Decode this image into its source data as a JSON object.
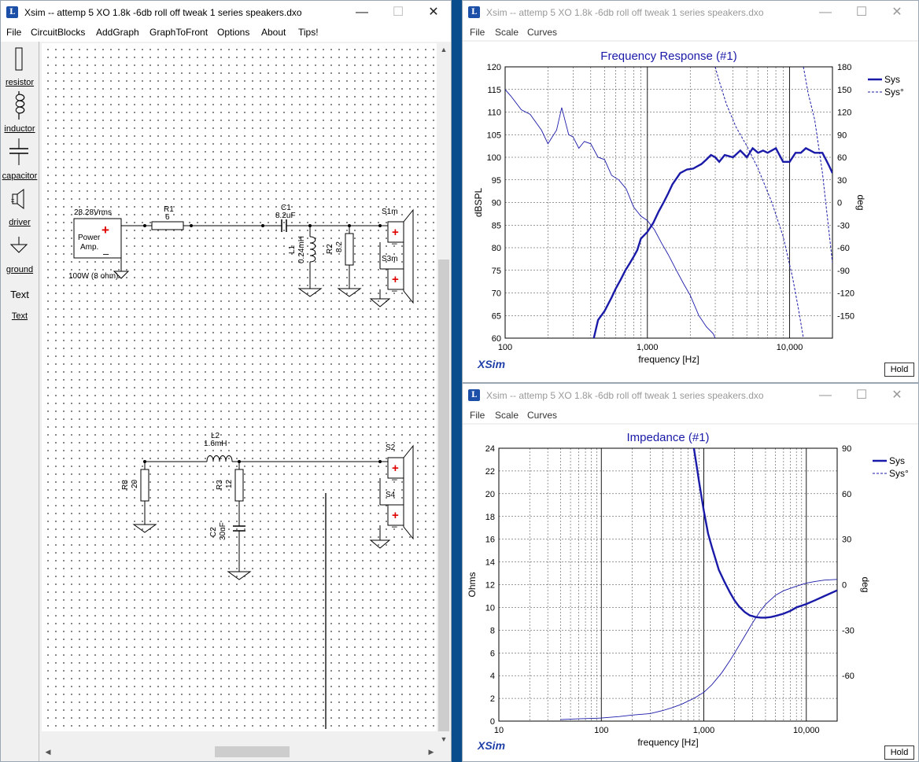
{
  "left_window": {
    "title": "Xsim -- attemp 5 XO 1.8k -6db roll off tweak 1 series speakers.dxo",
    "menu": [
      "File",
      "CircuitBlocks",
      "AddGraph",
      "GraphToFront",
      "Options",
      "About",
      "Tips!"
    ],
    "palette": [
      {
        "label": "resistor",
        "icon": "resistor-icon"
      },
      {
        "label": "inductor",
        "icon": "inductor-icon"
      },
      {
        "label": "capacitor",
        "icon": "capacitor-icon"
      },
      {
        "label": "driver",
        "icon": "driver-icon"
      },
      {
        "label": "ground",
        "icon": "ground-icon"
      },
      {
        "label": "Text",
        "icon": "text-icon"
      }
    ],
    "circuit": {
      "amp_voltage": "28.28Vrms",
      "amp_label_1": "Power",
      "amp_label_2": "Amp.",
      "amp_power": "100W (8 ohm)",
      "plus": "+",
      "minus": "–",
      "r1_name": "R1",
      "r1_value": "6",
      "c1_name": "C1",
      "c1_value": "8.2uF",
      "l1_name": "L1",
      "l1_value": "0.24mH",
      "r2_name": "R2",
      "r2_value": "8.2",
      "s1_name": "S1m",
      "s3_name": "S3m",
      "l2_name": "L2",
      "l2_value": "1.6mH",
      "r8_name": "R8",
      "r8_value": "20",
      "r3_name": "R3",
      "r3_value": "12",
      "c2_name": "C2",
      "c2_value": "30uF",
      "s2_name": "S2",
      "s4_name": "S4"
    }
  },
  "freq_window": {
    "title": "Xsim -- attemp 5 XO 1.8k -6db roll off tweak 1 series speakers.dxo",
    "menu": [
      "File",
      "Scale",
      "Curves"
    ],
    "hold_label": "Hold",
    "logo": "XSim"
  },
  "imp_window": {
    "title": "Xsim -- attemp 5 XO 1.8k -6db roll off tweak 1 series speakers.dxo",
    "menu": [
      "File",
      "Scale",
      "Curves"
    ],
    "hold_label": "Hold",
    "logo": "XSim"
  },
  "chart_data": [
    {
      "type": "line",
      "title": "Frequency Response (#1)",
      "xlabel": "frequency [Hz]",
      "ylabel": "dBSPL",
      "y2label": "deg",
      "xscale": "log",
      "xlim": [
        100,
        20000
      ],
      "ylim": [
        60,
        120
      ],
      "y2lim": [
        -180,
        180
      ],
      "x_ticks": [
        "100",
        "1,000",
        "10,000"
      ],
      "y_ticks": [
        60,
        65,
        70,
        75,
        80,
        85,
        90,
        95,
        100,
        105,
        110,
        115,
        120
      ],
      "y2_ticks": [
        -150,
        -120,
        -90,
        -60,
        -30,
        0,
        30,
        60,
        90,
        120,
        150,
        180
      ],
      "legend_position": "top-right",
      "grid": true,
      "accent_color": "#1a1aa8",
      "series": [
        {
          "name": "Sys",
          "axis": "left",
          "style": "solid-thick",
          "x": [
            420,
            450,
            500,
            560,
            600,
            650,
            700,
            750,
            800,
            850,
            900,
            1000,
            1100,
            1200,
            1300,
            1400,
            1500,
            1700,
            1900,
            2100,
            2400,
            2600,
            2800,
            3000,
            3200,
            3500,
            4000,
            4500,
            5000,
            5500,
            6000,
            6500,
            7000,
            8000,
            9000,
            10000,
            11000,
            12000,
            13000,
            14000,
            15000,
            16000,
            17000,
            18000,
            19000,
            20000
          ],
          "y": [
            60,
            64,
            66,
            69,
            71,
            73,
            75,
            76.5,
            78,
            79.5,
            82,
            83.5,
            85.5,
            88,
            90,
            92,
            94,
            96.5,
            97.3,
            97.5,
            98.5,
            99.5,
            100.5,
            100,
            99,
            100.5,
            100,
            101.5,
            100,
            102,
            101,
            101.5,
            101,
            102,
            99,
            99,
            101,
            101,
            102,
            101.5,
            101,
            101,
            101,
            99.5,
            98,
            96.5
          ]
        },
        {
          "name": "Sys°",
          "axis": "right",
          "style": "dashed",
          "x": [
            3000,
            3000,
            3150,
            3600,
            4200,
            5000,
            6000,
            7500,
            9000,
            10500,
            11500,
            12500,
            12500,
            13500,
            15000,
            17000,
            20000
          ],
          "y": [
            -180,
            180,
            165,
            130,
            100,
            75,
            45,
            0,
            -45,
            -100,
            -140,
            -180,
            180,
            145,
            110,
            40,
            -80
          ]
        },
        {
          "name": "",
          "axis": "left",
          "style": "thin",
          "x": [
            100,
            110,
            130,
            150,
            180,
            200,
            230,
            250,
            280,
            300,
            330,
            360,
            400,
            450,
            500,
            560,
            630,
            710,
            800,
            900,
            1000,
            1120,
            1260,
            1400,
            1600,
            1800,
            2000,
            2300,
            2600,
            2900,
            3000
          ],
          "y": [
            115,
            113.5,
            110.5,
            109.5,
            106,
            103,
            106,
            111,
            105,
            104.5,
            102,
            103.5,
            103,
            100,
            99.5,
            96,
            95,
            93,
            89,
            87,
            86,
            84,
            81,
            78.5,
            75,
            72,
            69.5,
            65,
            62.5,
            61,
            60
          ]
        }
      ]
    },
    {
      "type": "line",
      "title": "Impedance (#1)",
      "xlabel": "frequency [Hz]",
      "ylabel": "Ohms",
      "y2label": "deg",
      "xscale": "log",
      "xlim": [
        10,
        20000
      ],
      "ylim": [
        0,
        24
      ],
      "y2lim": [
        -90,
        90
      ],
      "x_ticks": [
        "10",
        "100",
        "1,000",
        "10,000"
      ],
      "y_ticks": [
        0,
        2,
        4,
        6,
        8,
        10,
        12,
        14,
        16,
        18,
        20,
        22,
        24
      ],
      "y2_ticks": [
        -60,
        -30,
        0,
        30,
        60,
        90
      ],
      "legend_position": "top-right",
      "grid": true,
      "series": [
        {
          "name": "Sys",
          "axis": "left",
          "style": "solid-thick",
          "x": [
            800,
            850,
            900,
            1000,
            1100,
            1200,
            1400,
            1600,
            1800,
            2000,
            2200,
            2500,
            2800,
            3200,
            3600,
            4000,
            4500,
            5000,
            6000,
            7000,
            8000,
            10000,
            12000,
            15000,
            20000
          ],
          "y": [
            24,
            22.5,
            21,
            18.5,
            16.5,
            15.3,
            13.3,
            12.2,
            11.3,
            10.6,
            10.1,
            9.6,
            9.3,
            9.15,
            9.1,
            9.1,
            9.15,
            9.25,
            9.45,
            9.7,
            10,
            10.3,
            10.6,
            11,
            11.5
          ]
        },
        {
          "name": "Sys°",
          "axis": "right",
          "style": "dashed",
          "x": [],
          "y": []
        },
        {
          "name": "",
          "axis": "right",
          "style": "thin",
          "x": [
            40,
            60,
            100,
            150,
            200,
            300,
            400,
            500,
            600,
            800,
            1000,
            1200,
            1500,
            1800,
            2000,
            2500,
            3000,
            3500,
            4000,
            5000,
            6000,
            8000,
            10000,
            12000,
            15000,
            20000
          ],
          "y": [
            -89,
            -88.5,
            -88,
            -87,
            -86,
            -85,
            -83,
            -81,
            -79,
            -75,
            -71,
            -66,
            -58,
            -50,
            -45,
            -34,
            -25,
            -18,
            -13,
            -7,
            -4,
            -1,
            1,
            2,
            3,
            3.5
          ]
        }
      ]
    }
  ]
}
